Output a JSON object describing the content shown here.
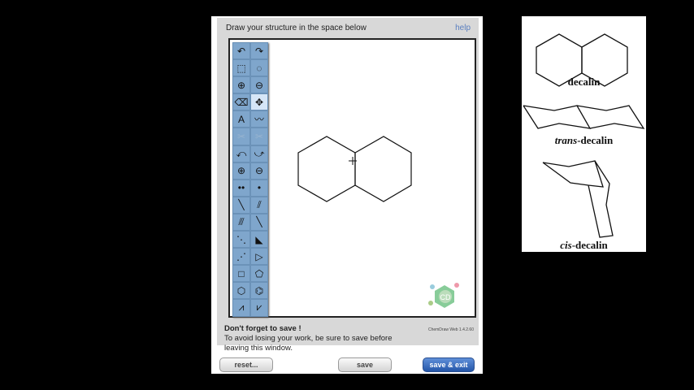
{
  "dialog": {
    "title": "Draw your structure in the space below",
    "help": "help",
    "toolbar": [
      [
        "undo-icon",
        "redo-icon"
      ],
      [
        "marquee-icon",
        "lasso-icon"
      ],
      [
        "zoom-in-icon",
        "zoom-out-icon"
      ],
      [
        "eraser-icon",
        "move-icon"
      ],
      [
        "text-icon",
        "chain-icon"
      ],
      [
        "cut-icon",
        "cut-alt-icon"
      ],
      [
        "arrow-curve-icon",
        "arrow-curve-alt-icon"
      ],
      [
        "plus-charge-icon",
        "minus-charge-icon"
      ],
      [
        "radical-pair-icon",
        "radical-icon"
      ],
      [
        "single-bond-icon",
        "double-bond-icon"
      ],
      [
        "triple-bond-icon",
        "bold-bond-icon"
      ],
      [
        "dashed-bond-icon",
        "wedge-bond-icon"
      ],
      [
        "hashed-wedge-icon",
        "triangle-icon"
      ],
      [
        "cyclobutane-icon",
        "cyclopentane-icon"
      ],
      [
        "cyclohexane-icon",
        "benzene-icon"
      ],
      [
        "cycloheptane-icon",
        "cyclooctane-icon"
      ]
    ],
    "warning_bold": "Don't forget to save !",
    "warning_text": "To avoid losing your work, be sure to save before leaving this window.",
    "version": "ChemDraw Web 1.4.2.60",
    "buttons": {
      "reset": "reset...",
      "save": "save",
      "save_exit": "save & exit"
    }
  },
  "reference": {
    "labels": {
      "decalin": "decalin",
      "trans_prefix": "trans",
      "trans_suffix": "-decalin",
      "cis_prefix": "cis",
      "cis_suffix": "-decalin"
    }
  }
}
